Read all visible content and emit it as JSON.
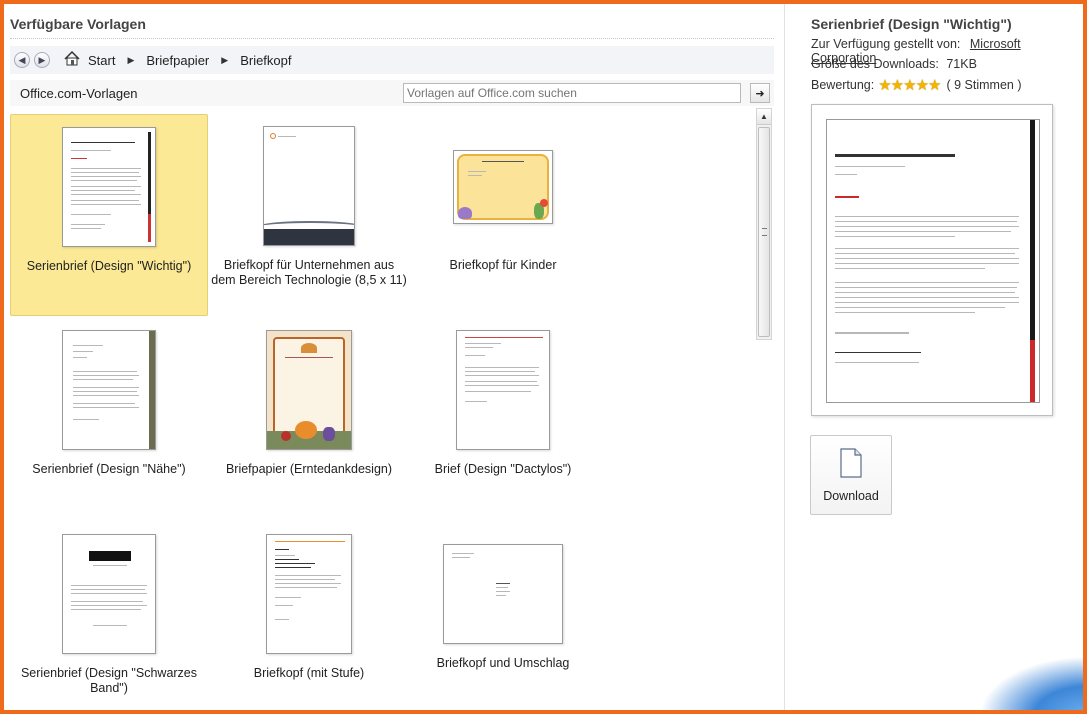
{
  "left_panel": {
    "heading": "Verfügbare Vorlagen",
    "breadcrumb": [
      "Start",
      "Briefpapier",
      "Briefkopf"
    ],
    "office_label": "Office.com-Vorlagen",
    "search_placeholder": "Vorlagen auf Office.com suchen"
  },
  "templates": [
    {
      "label": "Serienbrief (Design \"Wichtig\")",
      "selected": true
    },
    {
      "label": "Briefkopf für Unternehmen aus dem Bereich Technologie (8,5 x 11)",
      "selected": false
    },
    {
      "label": "Briefkopf für Kinder",
      "selected": false
    },
    {
      "label": "Serienbrief (Design \"Nähe\")",
      "selected": false
    },
    {
      "label": "Briefpapier (Erntedankdesign)",
      "selected": false
    },
    {
      "label": "Brief (Design \"Dactylos\")",
      "selected": false
    },
    {
      "label": "Serienbrief (Design \"Schwarzes Band\")",
      "selected": false
    },
    {
      "label": "Briefkopf (mit Stufe)",
      "selected": false
    },
    {
      "label": "Briefkopf und Umschlag",
      "selected": false
    }
  ],
  "details": {
    "title": "Serienbrief (Design \"Wichtig\")",
    "provider_label": "Zur Verfügung gestellt von:",
    "provider": "Microsoft Corporation",
    "size_label": "Größe des Downloads:",
    "size": "71KB",
    "rating_label": "Bewertung:",
    "rating_stars": 5,
    "votes": "( 9 Stimmen )",
    "download_label": "Download"
  },
  "colors": {
    "accent_selected": "#fbe995",
    "frame": "#f06a1c",
    "preview_bar": "#cc2a2a"
  }
}
